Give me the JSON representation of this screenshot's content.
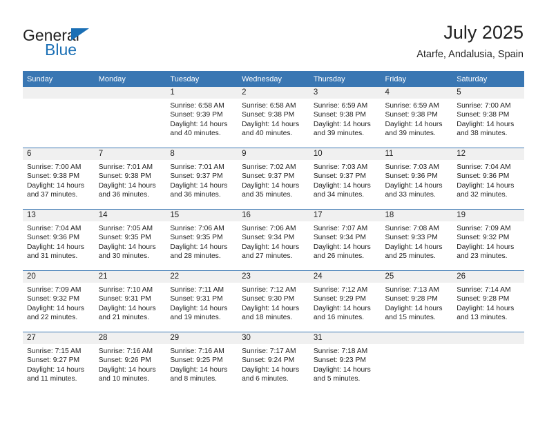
{
  "logo": {
    "word_top": "General",
    "word_bottom": "Blue",
    "triangle_color": "#1a6fb5",
    "icon": "general-blue-logo"
  },
  "header": {
    "title": "July 2025",
    "subtitle": "Atarfe, Andalusia, Spain"
  },
  "colors": {
    "header_blue": "#3a77b3",
    "daynum_band": "#f0f0f0",
    "text": "#222222"
  },
  "weekdays": [
    "Sunday",
    "Monday",
    "Tuesday",
    "Wednesday",
    "Thursday",
    "Friday",
    "Saturday"
  ],
  "labels": {
    "sunrise_prefix": "Sunrise:",
    "sunset_prefix": "Sunset:",
    "daylight_prefix": "Daylight:"
  },
  "weeks": [
    [
      {
        "day": "",
        "lines": []
      },
      {
        "day": "",
        "lines": []
      },
      {
        "day": "1",
        "lines": [
          "Sunrise: 6:58 AM",
          "Sunset: 9:39 PM",
          "Daylight: 14 hours",
          "and 40 minutes."
        ]
      },
      {
        "day": "2",
        "lines": [
          "Sunrise: 6:58 AM",
          "Sunset: 9:38 PM",
          "Daylight: 14 hours",
          "and 40 minutes."
        ]
      },
      {
        "day": "3",
        "lines": [
          "Sunrise: 6:59 AM",
          "Sunset: 9:38 PM",
          "Daylight: 14 hours",
          "and 39 minutes."
        ]
      },
      {
        "day": "4",
        "lines": [
          "Sunrise: 6:59 AM",
          "Sunset: 9:38 PM",
          "Daylight: 14 hours",
          "and 39 minutes."
        ]
      },
      {
        "day": "5",
        "lines": [
          "Sunrise: 7:00 AM",
          "Sunset: 9:38 PM",
          "Daylight: 14 hours",
          "and 38 minutes."
        ]
      }
    ],
    [
      {
        "day": "6",
        "lines": [
          "Sunrise: 7:00 AM",
          "Sunset: 9:38 PM",
          "Daylight: 14 hours",
          "and 37 minutes."
        ]
      },
      {
        "day": "7",
        "lines": [
          "Sunrise: 7:01 AM",
          "Sunset: 9:38 PM",
          "Daylight: 14 hours",
          "and 36 minutes."
        ]
      },
      {
        "day": "8",
        "lines": [
          "Sunrise: 7:01 AM",
          "Sunset: 9:37 PM",
          "Daylight: 14 hours",
          "and 36 minutes."
        ]
      },
      {
        "day": "9",
        "lines": [
          "Sunrise: 7:02 AM",
          "Sunset: 9:37 PM",
          "Daylight: 14 hours",
          "and 35 minutes."
        ]
      },
      {
        "day": "10",
        "lines": [
          "Sunrise: 7:03 AM",
          "Sunset: 9:37 PM",
          "Daylight: 14 hours",
          "and 34 minutes."
        ]
      },
      {
        "day": "11",
        "lines": [
          "Sunrise: 7:03 AM",
          "Sunset: 9:36 PM",
          "Daylight: 14 hours",
          "and 33 minutes."
        ]
      },
      {
        "day": "12",
        "lines": [
          "Sunrise: 7:04 AM",
          "Sunset: 9:36 PM",
          "Daylight: 14 hours",
          "and 32 minutes."
        ]
      }
    ],
    [
      {
        "day": "13",
        "lines": [
          "Sunrise: 7:04 AM",
          "Sunset: 9:36 PM",
          "Daylight: 14 hours",
          "and 31 minutes."
        ]
      },
      {
        "day": "14",
        "lines": [
          "Sunrise: 7:05 AM",
          "Sunset: 9:35 PM",
          "Daylight: 14 hours",
          "and 30 minutes."
        ]
      },
      {
        "day": "15",
        "lines": [
          "Sunrise: 7:06 AM",
          "Sunset: 9:35 PM",
          "Daylight: 14 hours",
          "and 28 minutes."
        ]
      },
      {
        "day": "16",
        "lines": [
          "Sunrise: 7:06 AM",
          "Sunset: 9:34 PM",
          "Daylight: 14 hours",
          "and 27 minutes."
        ]
      },
      {
        "day": "17",
        "lines": [
          "Sunrise: 7:07 AM",
          "Sunset: 9:34 PM",
          "Daylight: 14 hours",
          "and 26 minutes."
        ]
      },
      {
        "day": "18",
        "lines": [
          "Sunrise: 7:08 AM",
          "Sunset: 9:33 PM",
          "Daylight: 14 hours",
          "and 25 minutes."
        ]
      },
      {
        "day": "19",
        "lines": [
          "Sunrise: 7:09 AM",
          "Sunset: 9:32 PM",
          "Daylight: 14 hours",
          "and 23 minutes."
        ]
      }
    ],
    [
      {
        "day": "20",
        "lines": [
          "Sunrise: 7:09 AM",
          "Sunset: 9:32 PM",
          "Daylight: 14 hours",
          "and 22 minutes."
        ]
      },
      {
        "day": "21",
        "lines": [
          "Sunrise: 7:10 AM",
          "Sunset: 9:31 PM",
          "Daylight: 14 hours",
          "and 21 minutes."
        ]
      },
      {
        "day": "22",
        "lines": [
          "Sunrise: 7:11 AM",
          "Sunset: 9:31 PM",
          "Daylight: 14 hours",
          "and 19 minutes."
        ]
      },
      {
        "day": "23",
        "lines": [
          "Sunrise: 7:12 AM",
          "Sunset: 9:30 PM",
          "Daylight: 14 hours",
          "and 18 minutes."
        ]
      },
      {
        "day": "24",
        "lines": [
          "Sunrise: 7:12 AM",
          "Sunset: 9:29 PM",
          "Daylight: 14 hours",
          "and 16 minutes."
        ]
      },
      {
        "day": "25",
        "lines": [
          "Sunrise: 7:13 AM",
          "Sunset: 9:28 PM",
          "Daylight: 14 hours",
          "and 15 minutes."
        ]
      },
      {
        "day": "26",
        "lines": [
          "Sunrise: 7:14 AM",
          "Sunset: 9:28 PM",
          "Daylight: 14 hours",
          "and 13 minutes."
        ]
      }
    ],
    [
      {
        "day": "27",
        "lines": [
          "Sunrise: 7:15 AM",
          "Sunset: 9:27 PM",
          "Daylight: 14 hours",
          "and 11 minutes."
        ]
      },
      {
        "day": "28",
        "lines": [
          "Sunrise: 7:16 AM",
          "Sunset: 9:26 PM",
          "Daylight: 14 hours",
          "and 10 minutes."
        ]
      },
      {
        "day": "29",
        "lines": [
          "Sunrise: 7:16 AM",
          "Sunset: 9:25 PM",
          "Daylight: 14 hours",
          "and 8 minutes."
        ]
      },
      {
        "day": "30",
        "lines": [
          "Sunrise: 7:17 AM",
          "Sunset: 9:24 PM",
          "Daylight: 14 hours",
          "and 6 minutes."
        ]
      },
      {
        "day": "31",
        "lines": [
          "Sunrise: 7:18 AM",
          "Sunset: 9:23 PM",
          "Daylight: 14 hours",
          "and 5 minutes."
        ]
      },
      {
        "day": "",
        "lines": []
      },
      {
        "day": "",
        "lines": []
      }
    ]
  ]
}
